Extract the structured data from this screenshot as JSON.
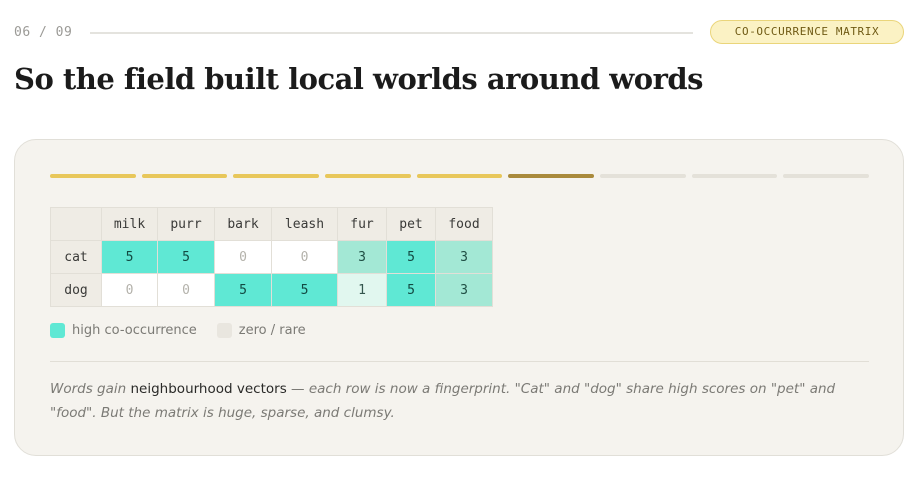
{
  "header": {
    "counter": "06 / 09",
    "tag": "CO-OCCURRENCE MATRIX"
  },
  "title": "So the field built local worlds around words",
  "progress": {
    "total_segments": 9,
    "completed": 5,
    "current_index": 6
  },
  "matrix": {
    "columns": [
      "milk",
      "purr",
      "bark",
      "leash",
      "fur",
      "pet",
      "food"
    ],
    "rows": [
      {
        "label": "cat",
        "values": [
          5,
          5,
          0,
          0,
          3,
          5,
          3
        ]
      },
      {
        "label": "dog",
        "values": [
          0,
          0,
          5,
          5,
          1,
          5,
          3
        ]
      }
    ]
  },
  "legend": {
    "high": "high co-occurrence",
    "zero": "zero / rare"
  },
  "caption": {
    "pre": "Words gain ",
    "highlight": "neighbourhood vectors",
    "post": " — each row is now a fingerprint. \"Cat\" and \"dog\" share high scores on \"pet\" and \"food\". But the matrix is huge, sparse, and clumsy."
  },
  "colors": {
    "accent_yellow": "#e8c75a",
    "accent_current": "#a98a3c",
    "high": "#5fe8d4",
    "mid": "#a3e8d5",
    "low": "#e1f7ef",
    "zero": "#ffffff"
  }
}
